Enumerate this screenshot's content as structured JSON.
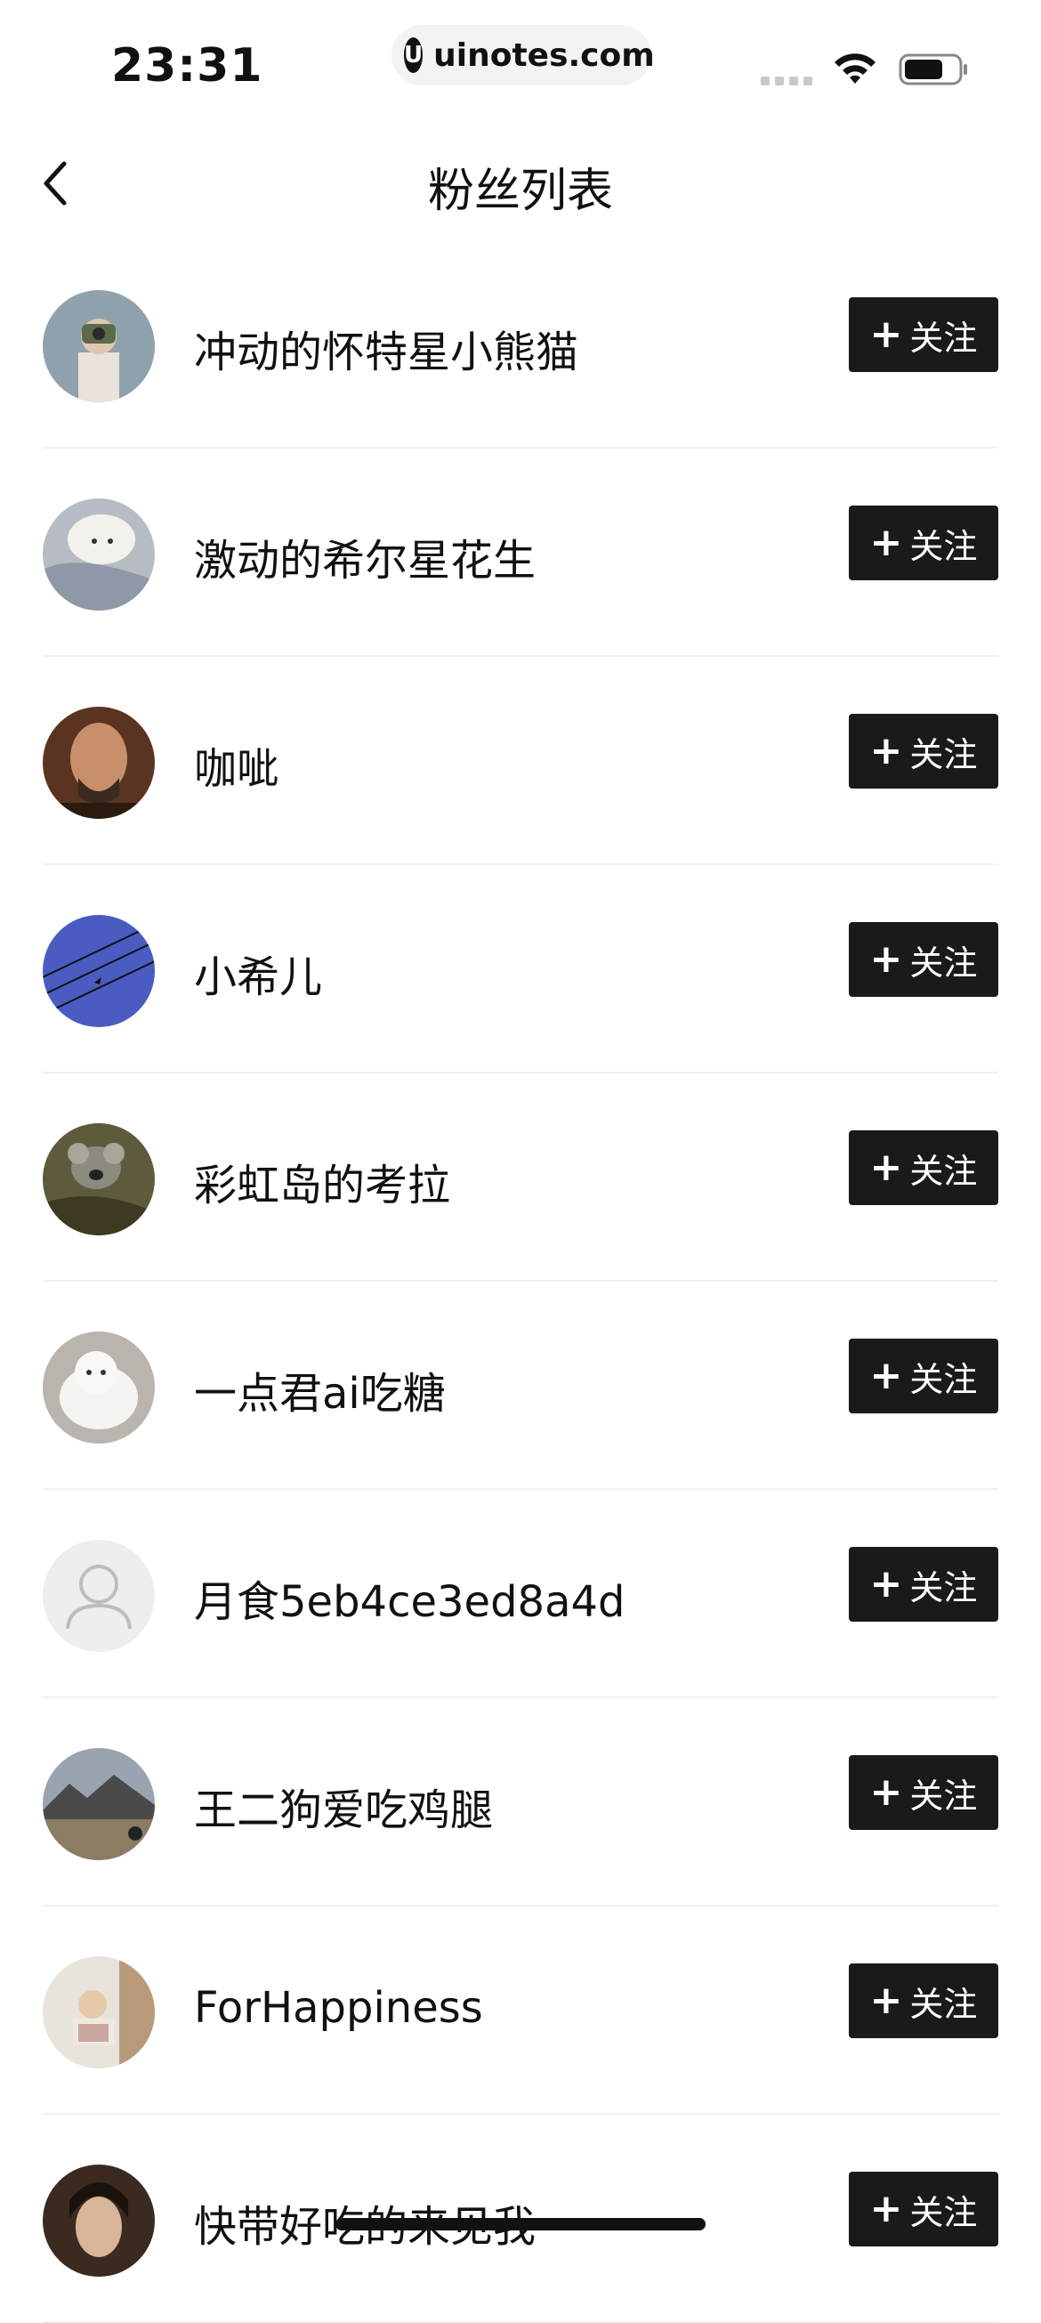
{
  "status_bar": {
    "time": "23:31",
    "url": "uinotes.com",
    "url_logo_glyph": "U"
  },
  "nav": {
    "title": "粉丝列表"
  },
  "follow": {
    "plus": "+",
    "label": "关注"
  },
  "fans": [
    {
      "name": "冲动的怀特星小熊猫",
      "avatar_color": "#8fa1ad",
      "avatar_type": "photo-camera-person"
    },
    {
      "name": "激动的希尔星花生",
      "avatar_color": "#b7bcc4",
      "avatar_type": "photo-dog"
    },
    {
      "name": "咖呲",
      "avatar_color": "#7a4a2c",
      "avatar_type": "photo-man"
    },
    {
      "name": "小希儿",
      "avatar_color": "#4a5cc2",
      "avatar_type": "photo-wires-bird"
    },
    {
      "name": "彩虹岛的考拉",
      "avatar_color": "#5e5a3c",
      "avatar_type": "photo-koala"
    },
    {
      "name": "一点君ai吃糖",
      "avatar_color": "#d9d6d2",
      "avatar_type": "photo-cat"
    },
    {
      "name": "月食5eb4ce3ed8a4d",
      "avatar_color": "#eeeeee",
      "avatar_type": "default-user-icon"
    },
    {
      "name": "王二狗爱吃鸡腿",
      "avatar_color": "#7d7a6c",
      "avatar_type": "photo-mountain"
    },
    {
      "name": "ForHappiness",
      "avatar_color": "#cfc6b8",
      "avatar_type": "photo-reading-woman"
    },
    {
      "name": "快带好吃的来见我",
      "avatar_color": "#4a3428",
      "avatar_type": "photo-woman"
    }
  ]
}
